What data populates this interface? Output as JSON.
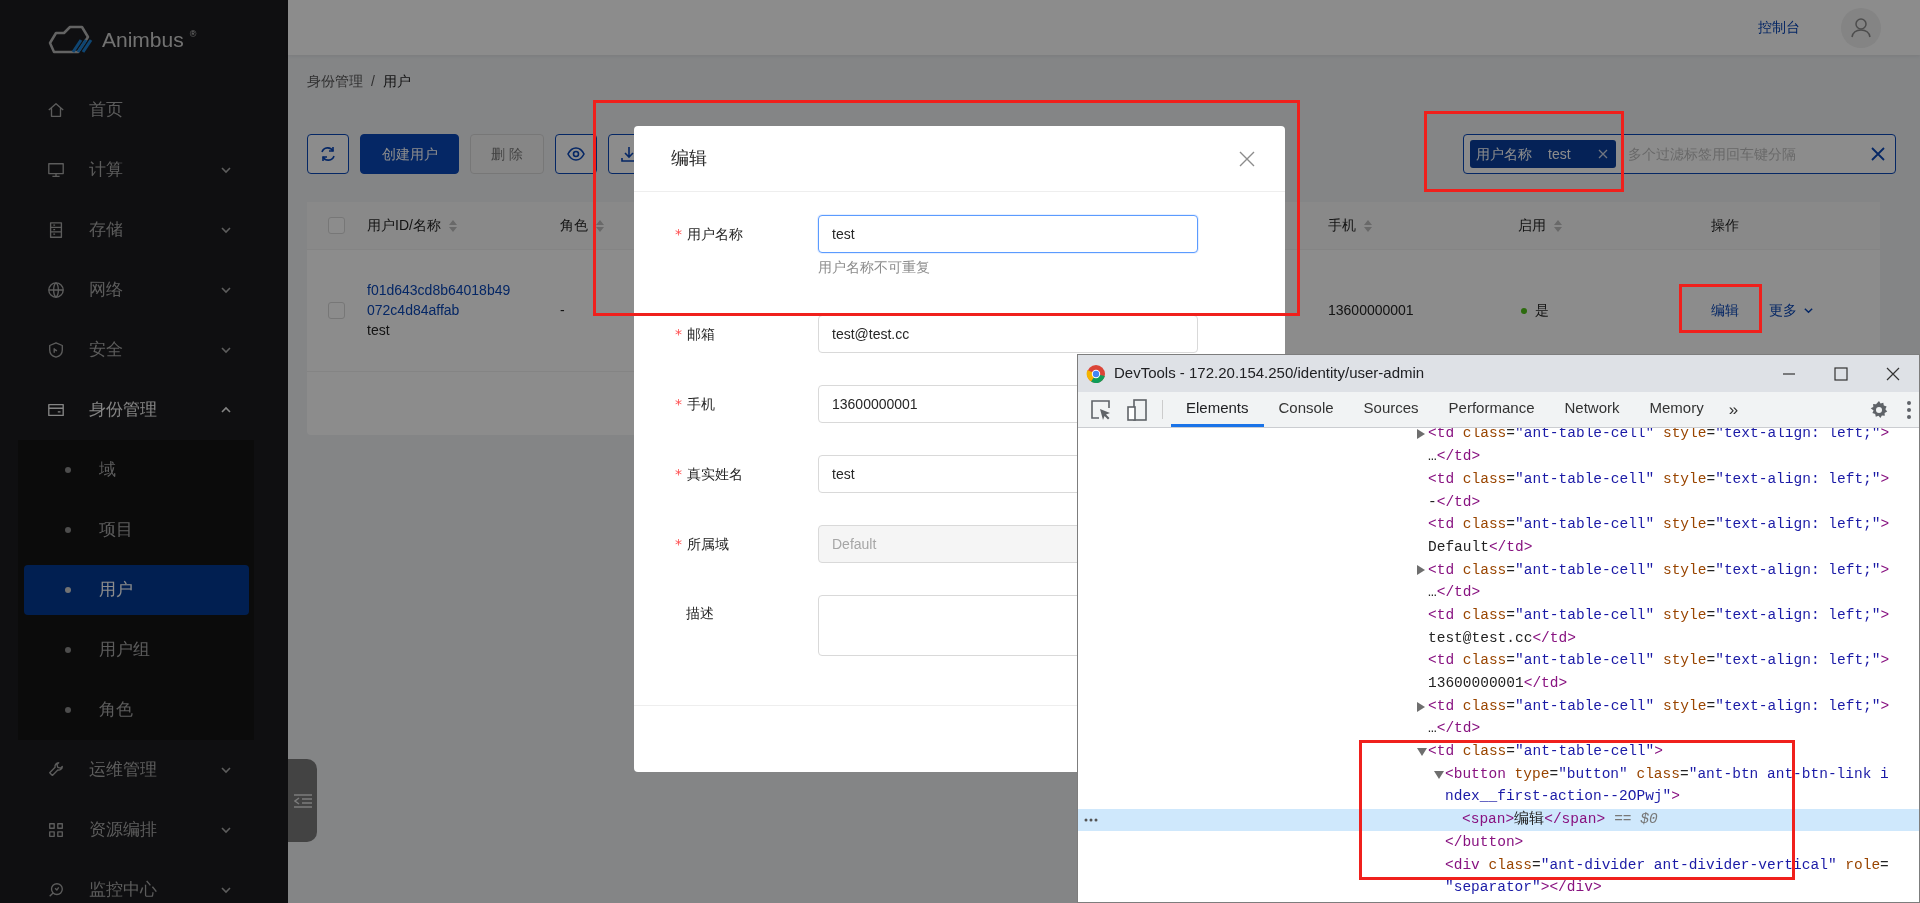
{
  "sidebar": {
    "logo": "Animbus",
    "logo_mark": "®",
    "items": [
      {
        "kind": "link",
        "label": "首页"
      },
      {
        "kind": "submenu",
        "label": "计算",
        "expanded": false
      },
      {
        "kind": "submenu",
        "label": "存储",
        "expanded": false
      },
      {
        "kind": "submenu",
        "label": "网络",
        "expanded": false
      },
      {
        "kind": "submenu",
        "label": "安全",
        "expanded": false
      },
      {
        "kind": "submenu",
        "label": "身份管理",
        "expanded": true,
        "children": [
          {
            "label": "域",
            "selected": false
          },
          {
            "label": "项目",
            "selected": false
          },
          {
            "label": "用户",
            "selected": true
          },
          {
            "label": "用户组",
            "selected": false
          },
          {
            "label": "角色",
            "selected": false
          }
        ]
      },
      {
        "kind": "submenu",
        "label": "运维管理",
        "expanded": false
      },
      {
        "kind": "submenu",
        "label": "资源编排",
        "expanded": false
      },
      {
        "kind": "submenu",
        "label": "监控中心",
        "expanded": false
      }
    ]
  },
  "header": {
    "console_link": "控制台"
  },
  "breadcrumb": {
    "items": [
      "身份管理",
      "用户"
    ],
    "separator": "/"
  },
  "toolbar": {
    "buttons": [
      {
        "kind": "refresh",
        "disabled": false
      },
      {
        "kind": "primary",
        "label": "创建用户",
        "disabled": false
      },
      {
        "kind": "default",
        "label": "删 除",
        "disabled": true
      },
      {
        "kind": "eye",
        "disabled": false
      },
      {
        "kind": "download",
        "disabled": false
      }
    ]
  },
  "search": {
    "tags": [
      {
        "key": "用户名称",
        "value": "test"
      }
    ],
    "placeholder": "多个过滤标签用回车键分隔"
  },
  "table": {
    "select_all": {
      "checked": false
    },
    "columns": [
      {
        "label": "用户ID/名称",
        "sortable": true
      },
      {
        "label": "角色",
        "sortable": true
      },
      {
        "label": "手机",
        "sortable": true
      },
      {
        "label": "启用",
        "sortable": true
      },
      {
        "label": "操作",
        "sortable": false
      }
    ],
    "rows": [
      {
        "checked": false,
        "id": "f01d643cd8b64018b49072c4d84affab",
        "name": "test",
        "role": "-",
        "phone": "13600000001",
        "enabled": {
          "on": true,
          "text": "是"
        },
        "edit": "编辑",
        "more": "更多"
      }
    ]
  },
  "modal": {
    "title": "编辑",
    "fields": [
      {
        "kind": "input",
        "required_mark": "*",
        "label": "用户名称",
        "value": "test",
        "help": "用户名称不可重复",
        "focused": true,
        "disabled": false
      },
      {
        "kind": "input",
        "required_mark": "*",
        "label": "邮箱",
        "value": "test@test.cc",
        "focused": false,
        "disabled": false
      },
      {
        "kind": "input",
        "required_mark": "*",
        "label": "手机",
        "value": "13600000001",
        "focused": false,
        "disabled": false
      },
      {
        "kind": "input",
        "required_mark": "*",
        "label": "真实姓名",
        "value": "test",
        "focused": false,
        "disabled": false
      },
      {
        "kind": "input",
        "required_mark": "*",
        "label": "所属域",
        "value": "Default",
        "focused": false,
        "disabled": true
      },
      {
        "kind": "textarea",
        "label": "描述",
        "focused": false
      }
    ]
  },
  "devtools": {
    "title": "DevTools - 172.20.154.250/identity/user-admin",
    "tabs": [
      {
        "label": "Elements",
        "selected": true
      },
      {
        "label": "Console",
        "selected": false
      },
      {
        "label": "Sources",
        "selected": false
      },
      {
        "label": "Performance",
        "selected": false
      },
      {
        "label": "Network",
        "selected": false
      },
      {
        "label": "Memory",
        "selected": false
      }
    ],
    "overflow": "»",
    "dom_tree": [
      {
        "kind": "collapsed",
        "selected": false,
        "lines": [
          "<td class=\"ant-table-cell\" style=\"text-align: left;\">",
          "…</td>"
        ]
      },
      {
        "kind": "leaf",
        "selected": false,
        "lines": [
          "<td class=\"ant-table-cell\" style=\"text-align: left;\">",
          "-</td>"
        ]
      },
      {
        "kind": "leaf",
        "selected": false,
        "lines": [
          "<td class=\"ant-table-cell\" style=\"text-align: left;\">",
          "Default</td>"
        ]
      },
      {
        "kind": "collapsed",
        "selected": false,
        "lines": [
          "<td class=\"ant-table-cell\" style=\"text-align: left;\">",
          "…</td>"
        ]
      },
      {
        "kind": "leaf",
        "selected": false,
        "lines": [
          "<td class=\"ant-table-cell\" style=\"text-align: left;\">",
          "test@test.cc</td>"
        ]
      },
      {
        "kind": "leaf",
        "selected": false,
        "lines": [
          "<td class=\"ant-table-cell\" style=\"text-align: left;\">",
          "13600000001</td>"
        ]
      },
      {
        "kind": "collapsed",
        "selected": false,
        "lines": [
          "<td class=\"ant-table-cell\" style=\"text-align: left;\">",
          "…</td>"
        ]
      },
      {
        "kind": "expanded",
        "selected": false,
        "lines": [
          "<td class=\"ant-table-cell\">"
        ],
        "children": [
          {
            "kind": "expanded",
            "selected": false,
            "lines": [
              "<button type=\"button\" class=\"ant-btn ant-btn-link i",
              "ndex__first-action--2OPwj\">"
            ],
            "closing": "</button>",
            "children": [
              {
                "kind": "leaf",
                "selected": true,
                "lines": [
                  "<span>编辑</span>"
                ],
                "console_ref": "== $0"
              }
            ]
          },
          {
            "kind": "leaf",
            "selected": false,
            "lines": [
              "<div class=\"ant-divider ant-divider-vertical\" role=",
              "\"separator\"></div>"
            ]
          }
        ]
      }
    ]
  }
}
